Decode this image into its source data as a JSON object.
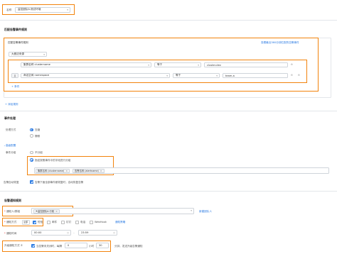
{
  "name_field": {
    "label": "名称",
    "value": "监控团队A-测试环境"
  },
  "match_section": {
    "title": "匹配告警事件规则",
    "box_title": "匹配告警事件规则",
    "recent_events_link": "查看最近360分钟匹配的告警事件",
    "rule_group": {
      "source_select": "大雅法来源",
      "conditions": [
        {
          "field_display": "集群名称 clustername",
          "op": "等于",
          "value": "cluster-dev"
        },
        {
          "connector": "且",
          "field_display": "命名空间 namespace",
          "op": "等于",
          "value": "team-a"
        }
      ],
      "add_condition": "+ 条件"
    },
    "add_rule": "+ 添加规则"
  },
  "event_section": {
    "title": "事件处理",
    "handle_mode": {
      "label": "处理方式",
      "options": [
        "压缩",
        "静默"
      ],
      "selected": 0
    },
    "advanced_link": "高级配置",
    "grouping": {
      "label": "事件分组",
      "options": [
        "不分组",
        "指定按照事件中的字段进行分组"
      ],
      "selected": 1,
      "fields": [
        "集群名称 (clustername)",
        "告警名称 (alertname)"
      ]
    },
    "auto_resolve": {
      "label": "告警自动恢复",
      "text": "告警下面全部事件都恢复时，自动恢复告警"
    }
  },
  "notify_section": {
    "title": "告警通知规则",
    "recipients": {
      "label": "通知人/群组",
      "tag": "监控团队A-行政",
      "add_link": "新建团队人"
    },
    "notify_methods": {
      "label": "通知方式",
      "select_value": "全部",
      "options": [
        {
          "label": "短信",
          "checked": true
        },
        {
          "label": "邮件",
          "checked": false
        },
        {
          "label": "钉钉",
          "checked": false
        },
        {
          "label": "电话",
          "checked": false
        },
        {
          "label": "WebHook",
          "checked": false
        }
      ],
      "link": "通知策略"
    },
    "notify_time": {
      "label": "通知时间",
      "start": "00:00",
      "end": "23:59"
    },
    "repeat_notify": {
      "label": "升级通知方式 ②",
      "text_prefix": "当告警未关闭时，每隔",
      "interval": "0",
      "unit": "小时",
      "minutes": "30",
      "text_suffix": "分钟，发送升级告警通知"
    }
  },
  "colors": {
    "highlight": "#f2830c",
    "link": "#2a7ae2"
  }
}
